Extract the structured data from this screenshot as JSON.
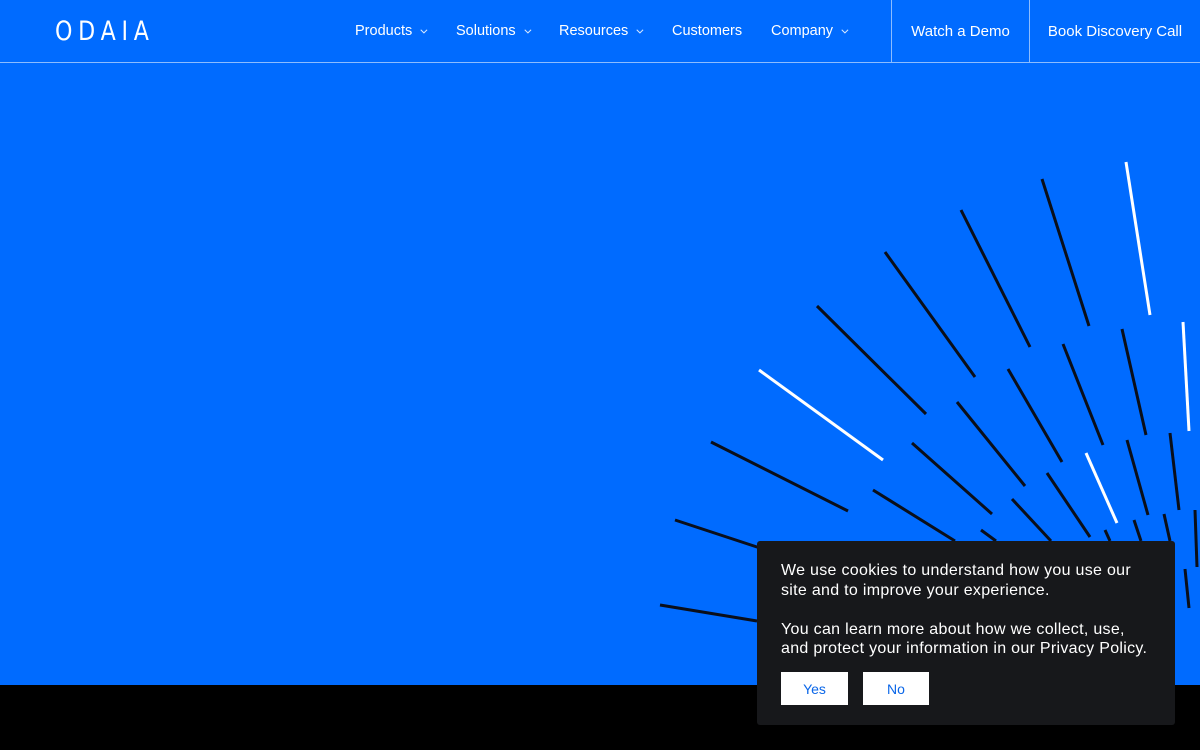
{
  "nav": {
    "logo": "ODAIA",
    "items": [
      {
        "label": "Products",
        "dropdown": true
      },
      {
        "label": "Solutions",
        "dropdown": true
      },
      {
        "label": "Resources",
        "dropdown": true
      },
      {
        "label": "Customers",
        "dropdown": false
      },
      {
        "label": "Company",
        "dropdown": true
      }
    ],
    "cta_demo": "Watch a Demo",
    "cta_discovery": "Book Discovery Call"
  },
  "cookie": {
    "line1": "We use cookies to understand how you use our site and to improve your experience.",
    "line2": "You can learn more about how we collect, use, and protect your information in our Privacy Policy.",
    "yes_label": "Yes",
    "no_label": "No"
  },
  "colors": {
    "hero_bg": "#006BFF",
    "footer_bg": "#000000",
    "banner_bg": "#17181B",
    "button_text": "#0A66E8"
  }
}
